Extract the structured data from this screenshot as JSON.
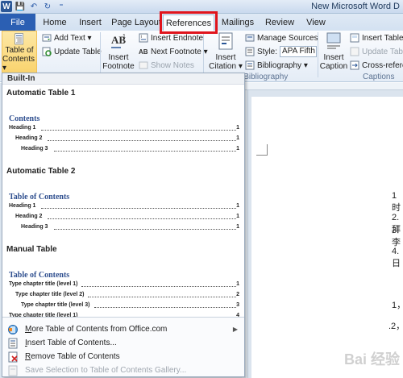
{
  "window": {
    "title": "New Microsoft Word D",
    "qat": [
      "W",
      "💾",
      "↶",
      "↻",
      "⁼"
    ]
  },
  "tabs": {
    "file": "File",
    "items": [
      "Home",
      "Insert",
      "Page Layout",
      "References",
      "Mailings",
      "Review",
      "View"
    ],
    "active": "References"
  },
  "ribbon": {
    "toc_button": [
      "Table of",
      "Contents ▾"
    ],
    "add_text": "Add Text ▾",
    "update_table": "Update Table",
    "insert_footnote": [
      "Insert",
      "Footnote"
    ],
    "insert_endnote": "Insert Endnote",
    "next_footnote": "Next Footnote ▾",
    "show_notes": "Show Notes",
    "insert_citation": [
      "Insert",
      "Citation ▾"
    ],
    "manage_sources": "Manage Sources",
    "style_label": "Style:",
    "style_value": "APA Fifth",
    "bibliography": "Bibliography ▾",
    "group_citations": "s & Bibliography",
    "insert_caption": [
      "Insert",
      "Caption"
    ],
    "insert_table_of": "Insert Table o",
    "update_table2": "Update Table",
    "cross_reference": "Cross-referen",
    "group_captions": "Captions"
  },
  "menu": {
    "section": "Built-In",
    "entries": [
      {
        "title": "Automatic Table 1",
        "preview_title": "Contents",
        "lines": [
          {
            "label": "Heading 1",
            "page": "1",
            "indent": 0
          },
          {
            "label": "Heading 2",
            "page": "1",
            "indent": 1
          },
          {
            "label": "Heading 3",
            "page": "1",
            "indent": 2
          }
        ]
      },
      {
        "title": "Automatic Table 2",
        "preview_title": "Table of Contents",
        "lines": [
          {
            "label": "Heading 1",
            "page": "1",
            "indent": 0
          },
          {
            "label": "Heading 2",
            "page": "1",
            "indent": 1
          },
          {
            "label": "Heading 3",
            "page": "1",
            "indent": 2
          }
        ]
      },
      {
        "title": "Manual Table",
        "preview_title": "Table of Contents",
        "lines": [
          {
            "label": "Type chapter title (level 1)",
            "page": "1",
            "indent": 0
          },
          {
            "label": "Type chapter title (level 2)",
            "page": "2",
            "indent": 1
          },
          {
            "label": "Type chapter title (level 3)",
            "page": "3",
            "indent": 2
          },
          {
            "label": "Type chapter title (level 1)",
            "page": "4",
            "indent": 0
          }
        ]
      }
    ],
    "commands": {
      "more": {
        "underline": "M",
        "rest": "ore Table of Contents from Office.com"
      },
      "insert": {
        "underline": "I",
        "rest": "nsert Table of Contents..."
      },
      "remove": {
        "underline": "R",
        "rest": "emove Table of Contents"
      },
      "save": "Save Selection to Table of Contents Gallery..."
    }
  },
  "document": {
    "lines": [
      "1时",
      "2.拜",
      "3.李",
      "4.日",
      "1，",
      ".2，"
    ],
    "watermark": "Bai 经验"
  }
}
